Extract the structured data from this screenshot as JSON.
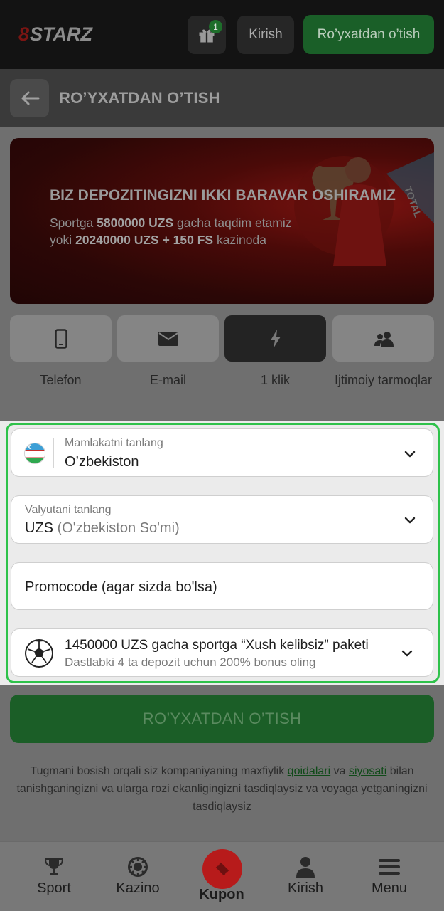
{
  "header": {
    "logo_text": "8STARZ",
    "gift_badge": "1",
    "login_label": "Kirish",
    "register_label": "Ro’yxatdan o’tish"
  },
  "subheader": {
    "title": "RO’YXATDAN O’TISH"
  },
  "banner": {
    "title": "BIZ DEPOZITINGIZNI IKKI BARAVAR OSHIRAMIZ",
    "line1_pre": "Sportga ",
    "line1_bold": "5800000 UZS",
    "line1_post": " gacha taqdim etamiz",
    "line2_pre": "yoki ",
    "line2_bold": "20240000 UZS + 150 FS",
    "line2_post": " kazinoda"
  },
  "tabs": [
    {
      "label": "Telefon",
      "icon": "phone-icon"
    },
    {
      "label": "E-mail",
      "icon": "envelope-icon"
    },
    {
      "label": "1 klik",
      "icon": "lightning-icon"
    },
    {
      "label": "Ijtimoiy tarmoqlar",
      "icon": "users-icon"
    }
  ],
  "active_tab": "1 klik",
  "form": {
    "country_label": "Mamlakatni tanlang",
    "country_value": "O’zbekiston",
    "currency_label": "Valyutani tanlang",
    "currency_code": "UZS",
    "currency_name": "(O'zbekiston So'mi)",
    "promocode_placeholder": "Promocode (agar sizda bo'lsa)",
    "bonus_title": "1450000 UZS gacha sportga “Xush kelibsiz” paketi",
    "bonus_subtitle": "Dastlabki 4 ta depozit uchun 200% bonus oling",
    "submit_label": "RO’YXATDAN O’TISH"
  },
  "terms": {
    "text_pre": "Tugmani bosish orqali siz kompaniyaning maxfiylik ",
    "link1": "qoidalari",
    "text_mid": " va ",
    "link2": "siyosati",
    "text_post": " bilan tanishganingizni va ularga rozi ekanligingizni tasdiqlaysiz va voyaga yetganingizni tasdiqlaysiz"
  },
  "bottom_nav": [
    {
      "label": "Sport",
      "icon": "trophy-icon"
    },
    {
      "label": "Kazino",
      "icon": "casino-chip-icon"
    },
    {
      "label": "Kupon",
      "icon": "ticket-icon"
    },
    {
      "label": "Kirish",
      "icon": "user-icon"
    },
    {
      "label": "Menu",
      "icon": "hamburger-icon"
    }
  ],
  "colors": {
    "brand_green": "#1b5e27",
    "outline_green": "#2ec24a",
    "kupon_red": "#b71b1b"
  }
}
